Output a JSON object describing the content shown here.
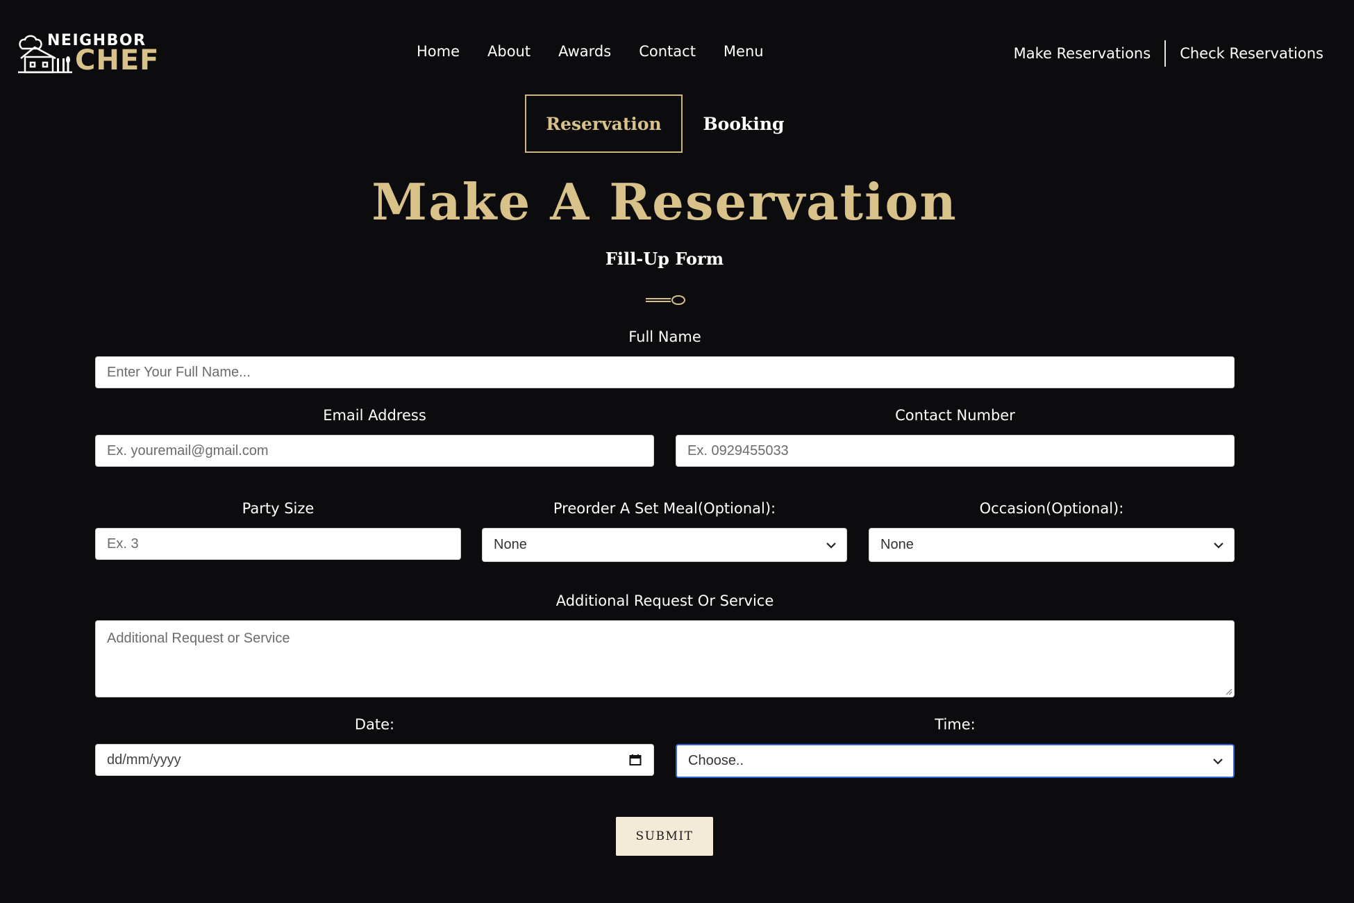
{
  "brand": {
    "name_top": "NEIGHBOR",
    "name_bottom": "CHEF",
    "accent": "#d8c289"
  },
  "nav": {
    "items": [
      "Home",
      "About",
      "Awards",
      "Contact",
      "Menu"
    ],
    "make_reservations": "Make Reservations",
    "check_reservations": "Check Reservations"
  },
  "tabs": {
    "reservation": "Reservation",
    "booking": "Booking",
    "active": "Reservation"
  },
  "header": {
    "title": "Make A Reservation",
    "subtitle": "Fill-Up Form"
  },
  "form": {
    "full_name": {
      "label": "Full Name",
      "placeholder": "Enter Your Full Name..."
    },
    "email": {
      "label": "Email Address",
      "placeholder": "Ex. youremail@gmail.com"
    },
    "contact": {
      "label": "Contact Number",
      "placeholder": "Ex. 0929455033"
    },
    "party_size": {
      "label": "Party Size",
      "placeholder": "Ex. 3"
    },
    "preorder": {
      "label": "Preorder A Set Meal(Optional):",
      "value": "None"
    },
    "occasion": {
      "label": "Occasion(Optional):",
      "value": "None"
    },
    "additional": {
      "label": "Additional Request Or Service",
      "placeholder": "Additional Request or Service"
    },
    "date": {
      "label": "Date:",
      "placeholder": "dd/mm/yyyy"
    },
    "time": {
      "label": "Time:",
      "value": "Choose.."
    },
    "submit_label": "SUBMIT"
  },
  "icons": {
    "logo": "chef-house-logo-icon",
    "divider": "spoon-divider-icon",
    "dropdown": "chevron-down-icon",
    "calendar": "calendar-icon",
    "resize": "resize-grip-icon"
  }
}
